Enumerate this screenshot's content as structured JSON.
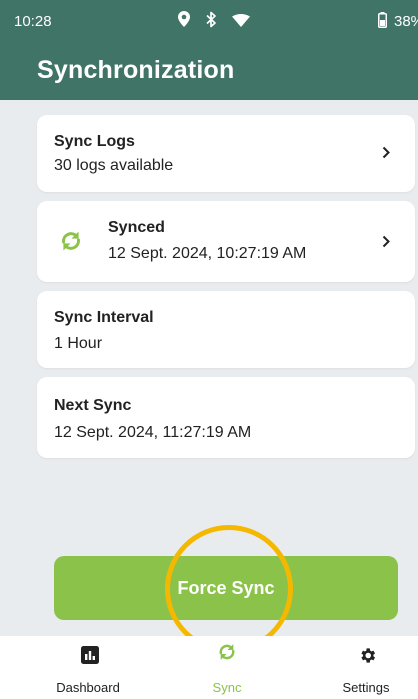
{
  "status_bar": {
    "time": "10:28",
    "battery": "38%"
  },
  "header": {
    "title": "Synchronization"
  },
  "cards": {
    "sync_logs": {
      "title": "Sync Logs",
      "subtitle": "30 logs available"
    },
    "sync_status": {
      "title": "Synced",
      "subtitle": "12 Sept. 2024, 10:27:19 AM"
    },
    "sync_interval": {
      "title": "Sync Interval",
      "subtitle": "1 Hour"
    },
    "next_sync": {
      "title": "Next Sync",
      "subtitle": "12 Sept. 2024, 11:27:19 AM"
    }
  },
  "force_sync": {
    "label": "Force Sync"
  },
  "nav": {
    "items": [
      {
        "label": "Dashboard",
        "icon": "bar-chart-icon"
      },
      {
        "label": "Sync",
        "icon": "sync-icon",
        "active": true
      },
      {
        "label": "Settings",
        "icon": "gear-icon"
      }
    ]
  },
  "colors": {
    "header": "#3f7467",
    "accent_green": "#8bc34a",
    "highlight": "#f5b800",
    "background": "#e9ecee"
  }
}
